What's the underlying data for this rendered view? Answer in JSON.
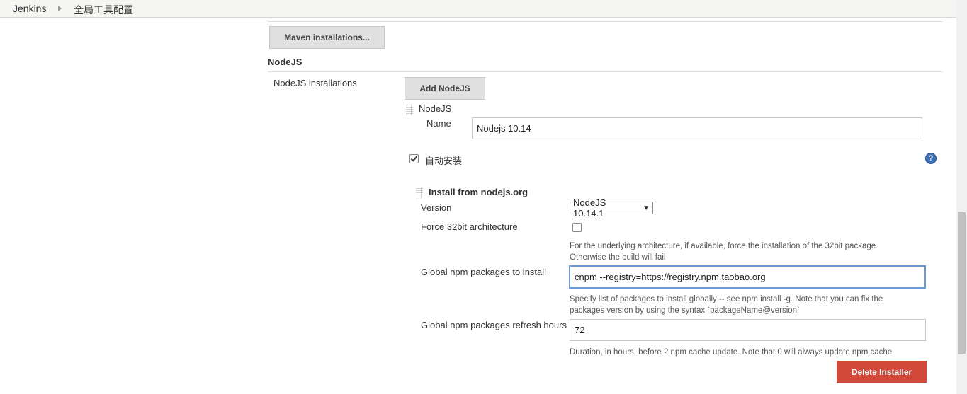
{
  "breadcrumb": {
    "home": "Jenkins",
    "current": "全局工具配置"
  },
  "maven": {
    "button_label": "Maven installations..."
  },
  "nodejs_section": {
    "title": "NodeJS",
    "installations_label": "NodeJS installations",
    "add_button_label": "Add NodeJS",
    "item_header": "NodeJS",
    "name_label": "Name",
    "name_value": "Nodejs 10.14",
    "auto_install_label": "自动安装",
    "auto_install_checked": true,
    "help_icon": "question-icon",
    "installer": {
      "title": "Install from nodejs.org",
      "version_label": "Version",
      "version_value": "NodeJS 10.14.1",
      "force32_label": "Force 32bit architecture",
      "force32_checked": false,
      "force32_help_1": "For the underlying architecture, if available, force the installation of the 32bit package.",
      "force32_help_2": "Otherwise the build will fail",
      "npm_packages_label": "Global npm packages to install",
      "npm_packages_value": "cnpm --registry=https://registry.npm.taobao.org",
      "npm_packages_help_1": "Specify list of packages to install globally -- see npm install -g. Note that you can fix the",
      "npm_packages_help_2": "packages version by using the syntax `packageName@version`",
      "refresh_label": "Global npm packages refresh hours",
      "refresh_value": "72",
      "refresh_help": "Duration, in hours, before 2 npm cache update. Note that 0 will always update npm cache",
      "delete_button_label": "Delete Installer"
    }
  },
  "colors": {
    "danger": "#d24939",
    "help_blue": "#3b6fb6",
    "focus_border": "#6a9bd8"
  }
}
